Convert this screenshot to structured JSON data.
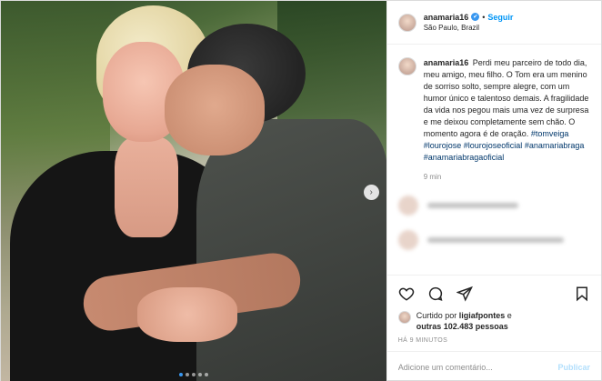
{
  "photo": {
    "nav_next": "›",
    "dots": [
      true,
      false,
      false,
      false,
      false
    ]
  },
  "header": {
    "username": "anamaria16",
    "verified": "✔",
    "separator": "•",
    "follow": "Seguir",
    "location": "São Paulo, Brazil"
  },
  "caption": {
    "username": "anamaria16",
    "text": "Perdi meu parceiro de todo dia, meu amigo, meu filho. O Tom era um menino de sorriso solto, sempre alegre, com um humor único e talentoso demais. A fragilidade da vida nos pegou mais uma vez de surpresa e me deixou completamente sem chão. O momento agora é de oração.",
    "hashtags": [
      "#tomveiga",
      "#lourojose",
      "#lourojoseoficial",
      "#anamariabraga",
      "#anamariabragaoficial"
    ],
    "time": "9 min"
  },
  "actions": {
    "liked_prefix": "Curtido por",
    "liked_user": "ligiafpontes",
    "liked_and": "e",
    "liked_others": "outras 102.483 pessoas",
    "post_age": "HÁ 9 MINUTOS"
  },
  "comment_box": {
    "placeholder": "Adicione um comentário...",
    "publish": "Publicar"
  },
  "colors": {
    "accent": "#0095f6",
    "verified": "#3897f0",
    "hashtag": "#00376b"
  }
}
